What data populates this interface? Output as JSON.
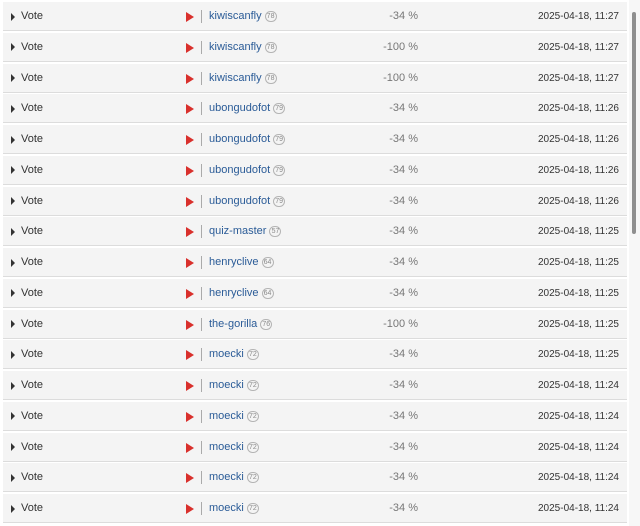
{
  "vote_label": "Vote",
  "rows": [
    {
      "user": "kiwiscanfly",
      "rep": "78",
      "pct": "-34 %",
      "time": "2025-04-18, 11:27"
    },
    {
      "user": "kiwiscanfly",
      "rep": "78",
      "pct": "-100 %",
      "time": "2025-04-18, 11:27"
    },
    {
      "user": "kiwiscanfly",
      "rep": "78",
      "pct": "-100 %",
      "time": "2025-04-18, 11:27"
    },
    {
      "user": "ubongudofot",
      "rep": "79",
      "pct": "-34 %",
      "time": "2025-04-18, 11:26"
    },
    {
      "user": "ubongudofot",
      "rep": "79",
      "pct": "-34 %",
      "time": "2025-04-18, 11:26"
    },
    {
      "user": "ubongudofot",
      "rep": "79",
      "pct": "-34 %",
      "time": "2025-04-18, 11:26"
    },
    {
      "user": "ubongudofot",
      "rep": "79",
      "pct": "-34 %",
      "time": "2025-04-18, 11:26"
    },
    {
      "user": "quiz-master",
      "rep": "57",
      "pct": "-34 %",
      "time": "2025-04-18, 11:25"
    },
    {
      "user": "henryclive",
      "rep": "64",
      "pct": "-34 %",
      "time": "2025-04-18, 11:25"
    },
    {
      "user": "henryclive",
      "rep": "64",
      "pct": "-34 %",
      "time": "2025-04-18, 11:25"
    },
    {
      "user": "the-gorilla",
      "rep": "76",
      "pct": "-100 %",
      "time": "2025-04-18, 11:25"
    },
    {
      "user": "moecki",
      "rep": "72",
      "pct": "-34 %",
      "time": "2025-04-18, 11:25"
    },
    {
      "user": "moecki",
      "rep": "72",
      "pct": "-34 %",
      "time": "2025-04-18, 11:24"
    },
    {
      "user": "moecki",
      "rep": "72",
      "pct": "-34 %",
      "time": "2025-04-18, 11:24"
    },
    {
      "user": "moecki",
      "rep": "72",
      "pct": "-34 %",
      "time": "2025-04-18, 11:24"
    },
    {
      "user": "moecki",
      "rep": "72",
      "pct": "-34 %",
      "time": "2025-04-18, 11:24"
    },
    {
      "user": "moecki",
      "rep": "72",
      "pct": "-34 %",
      "time": "2025-04-18, 11:24"
    }
  ],
  "colors": {
    "play_icon": "#d9302c",
    "username": "#2a5b97",
    "row_background": "#f4f4f4"
  }
}
